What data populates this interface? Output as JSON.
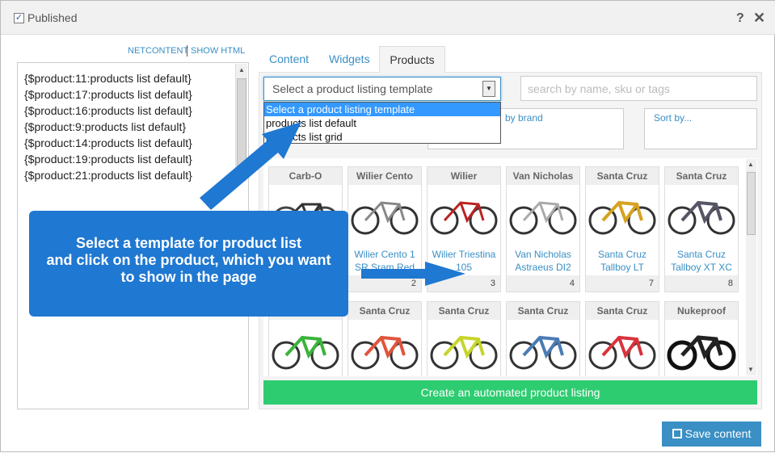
{
  "header": {
    "published_label": "Published",
    "help_glyph": "?",
    "close_glyph": "✕"
  },
  "editor_links": {
    "netcontent": "NETCONTENT",
    "show_html": "SHOW HTML"
  },
  "editor_lines": [
    "{$product:11:products list default}",
    "{$product:17:products list default}",
    "{$product:16:products list default}",
    "{$product:9:products list default}",
    "{$product:14:products list default}",
    "{$product:19:products list default}",
    "{$product:21:products list default}"
  ],
  "tabs": {
    "content": "Content",
    "widgets": "Widgets",
    "products": "Products"
  },
  "template_select": {
    "value": "Select a product listing template",
    "options": [
      "Select a product listing template",
      "products list default",
      "products list grid"
    ]
  },
  "search": {
    "placeholder": "search by name, sku or tags"
  },
  "filters": {
    "brand": "by brand",
    "sort": "Sort by..."
  },
  "products_row1": [
    {
      "brand": "Carb-O",
      "name": "",
      "num": ""
    },
    {
      "brand": "Wilier Cento",
      "name": "Wilier Cento 1 SR Sram Red",
      "num": "2"
    },
    {
      "brand": "Wilier",
      "name": "Wilier Triestina 105",
      "num": "3"
    },
    {
      "brand": "Van Nicholas",
      "name": "Van Nicholas Astraeus DI2",
      "num": "4"
    },
    {
      "brand": "Santa Cruz",
      "name": "Santa Cruz Tallboy LT",
      "num": "7"
    },
    {
      "brand": "Santa Cruz",
      "name": "Santa Cruz Tallboy XT XC",
      "num": "8"
    }
  ],
  "products_row2": [
    {
      "brand": ""
    },
    {
      "brand": "Santa Cruz"
    },
    {
      "brand": "Santa Cruz"
    },
    {
      "brand": "Santa Cruz"
    },
    {
      "brand": "Santa Cruz"
    },
    {
      "brand": "Nukeproof"
    }
  ],
  "actions": {
    "create": "Create an automated product listing",
    "save": "Save content"
  },
  "callout": {
    "line1": "Select a template for product list",
    "line2": "and click  on the product, which you want",
    "line3": "to show in the page"
  },
  "colors": {
    "accent": "#3a8fc4",
    "green": "#2ecc71",
    "callout": "#1f78d1"
  }
}
